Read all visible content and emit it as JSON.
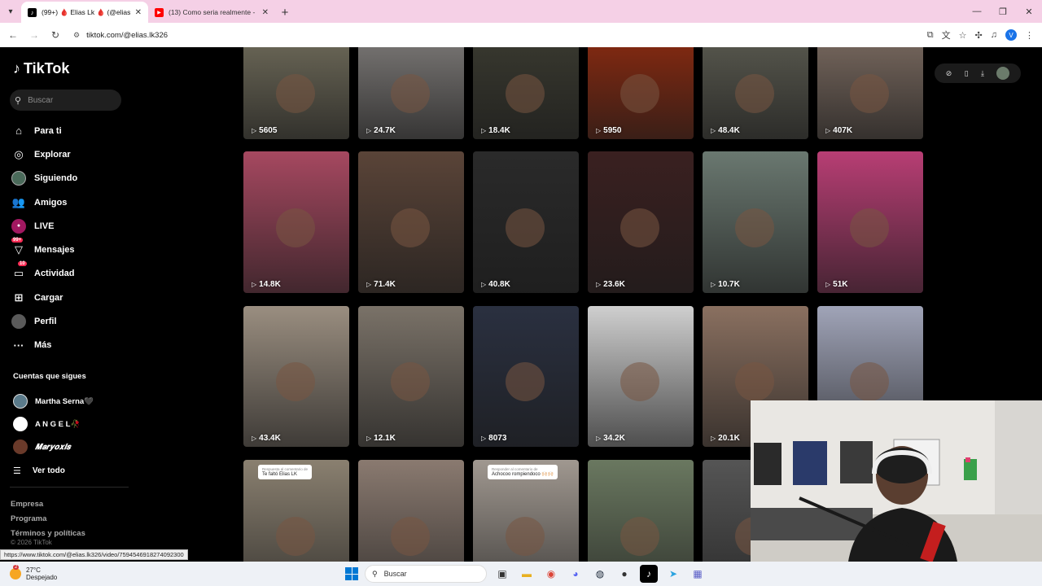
{
  "browser": {
    "tabs": [
      {
        "title": "(99+) 🩸 Elias Lk 🩸 (@elias.lk32…",
        "favicon": "tiktok-icon",
        "active": true
      },
      {
        "title": "(13) Como seria realmente - De…",
        "favicon": "youtube-icon",
        "active": false
      }
    ],
    "url": "tiktok.com/@elias.lk326"
  },
  "sidebar": {
    "logo": "TikTok",
    "search_placeholder": "Buscar",
    "nav": [
      {
        "label": "Para ti",
        "icon": "home-icon"
      },
      {
        "label": "Explorar",
        "icon": "compass-icon"
      },
      {
        "label": "Siguiendo",
        "icon": "following-avatar-icon"
      },
      {
        "label": "Amigos",
        "icon": "friends-icon"
      },
      {
        "label": "LIVE",
        "icon": "live-icon"
      },
      {
        "label": "Mensajes",
        "icon": "messages-icon",
        "badge": "99+"
      },
      {
        "label": "Actividad",
        "icon": "activity-icon",
        "badge": "10"
      },
      {
        "label": "Cargar",
        "icon": "upload-icon"
      },
      {
        "label": "Perfil",
        "icon": "profile-avatar-icon"
      },
      {
        "label": "Más",
        "icon": "more-icon"
      }
    ],
    "following_title": "Cuentas que sigues",
    "following": [
      {
        "name": "Martha Serna🖤"
      },
      {
        "name": "A N G E L🥀"
      },
      {
        "name": "𝑴𝒂𝒓𝒚𝒐𝒙𝒊𝒔"
      }
    ],
    "see_all": "Ver todo",
    "footer_links": [
      "Empresa",
      "Programa",
      "Términos y políticas"
    ],
    "copyright": "© 2026 TikTok"
  },
  "videos": [
    {
      "views": "5605",
      "color": "#6f6b5a"
    },
    {
      "views": "24.7K",
      "color": "#7d7a78"
    },
    {
      "views": "18.4K",
      "color": "#3a3a30"
    },
    {
      "views": "5950",
      "color": "#8a2a10"
    },
    {
      "views": "48.4K",
      "color": "#5a5a50"
    },
    {
      "views": "407K",
      "color": "#7a6a60"
    },
    {
      "views": "14.8K",
      "color": "#a64860"
    },
    {
      "views": "71.4K",
      "color": "#5a4438"
    },
    {
      "views": "40.8K",
      "color": "#2a2a2a"
    },
    {
      "views": "23.6K",
      "color": "#3a2020"
    },
    {
      "views": "10.7K",
      "color": "#6a7870"
    },
    {
      "views": "51K",
      "color": "#b83e74"
    },
    {
      "views": "43.4K",
      "color": "#9a8e80"
    },
    {
      "views": "12.1K",
      "color": "#7a7268"
    },
    {
      "views": "8073",
      "color": "#2a3040"
    },
    {
      "views": "34.2K",
      "color": "#cfcfcf"
    },
    {
      "views": "20.1K",
      "color": "#8a7060"
    },
    {
      "views": "",
      "color": "#a0a4b8"
    },
    {
      "views": "",
      "color": "#8a8070",
      "caption": "Te faltó Elias LK",
      "caption_sub": "Respuesta al comentario de"
    },
    {
      "views": "",
      "color": "#8a7a70"
    },
    {
      "views": "",
      "color": "#a09890",
      "caption": "Achocoo rompiendoco 🙌🏻🙌🏻",
      "caption_sub": "Responder al comentario de"
    },
    {
      "views": "",
      "color": "#6a7860"
    },
    {
      "views": "",
      "color": "#555"
    }
  ],
  "link_tooltip": "https://www.tiktok.com/@elias.lk326/video/7594546918274092300",
  "taskbar": {
    "weather_temp": "27°C",
    "weather_desc": "Despejado",
    "weather_badge": "2",
    "search_placeholder": "Buscar"
  }
}
